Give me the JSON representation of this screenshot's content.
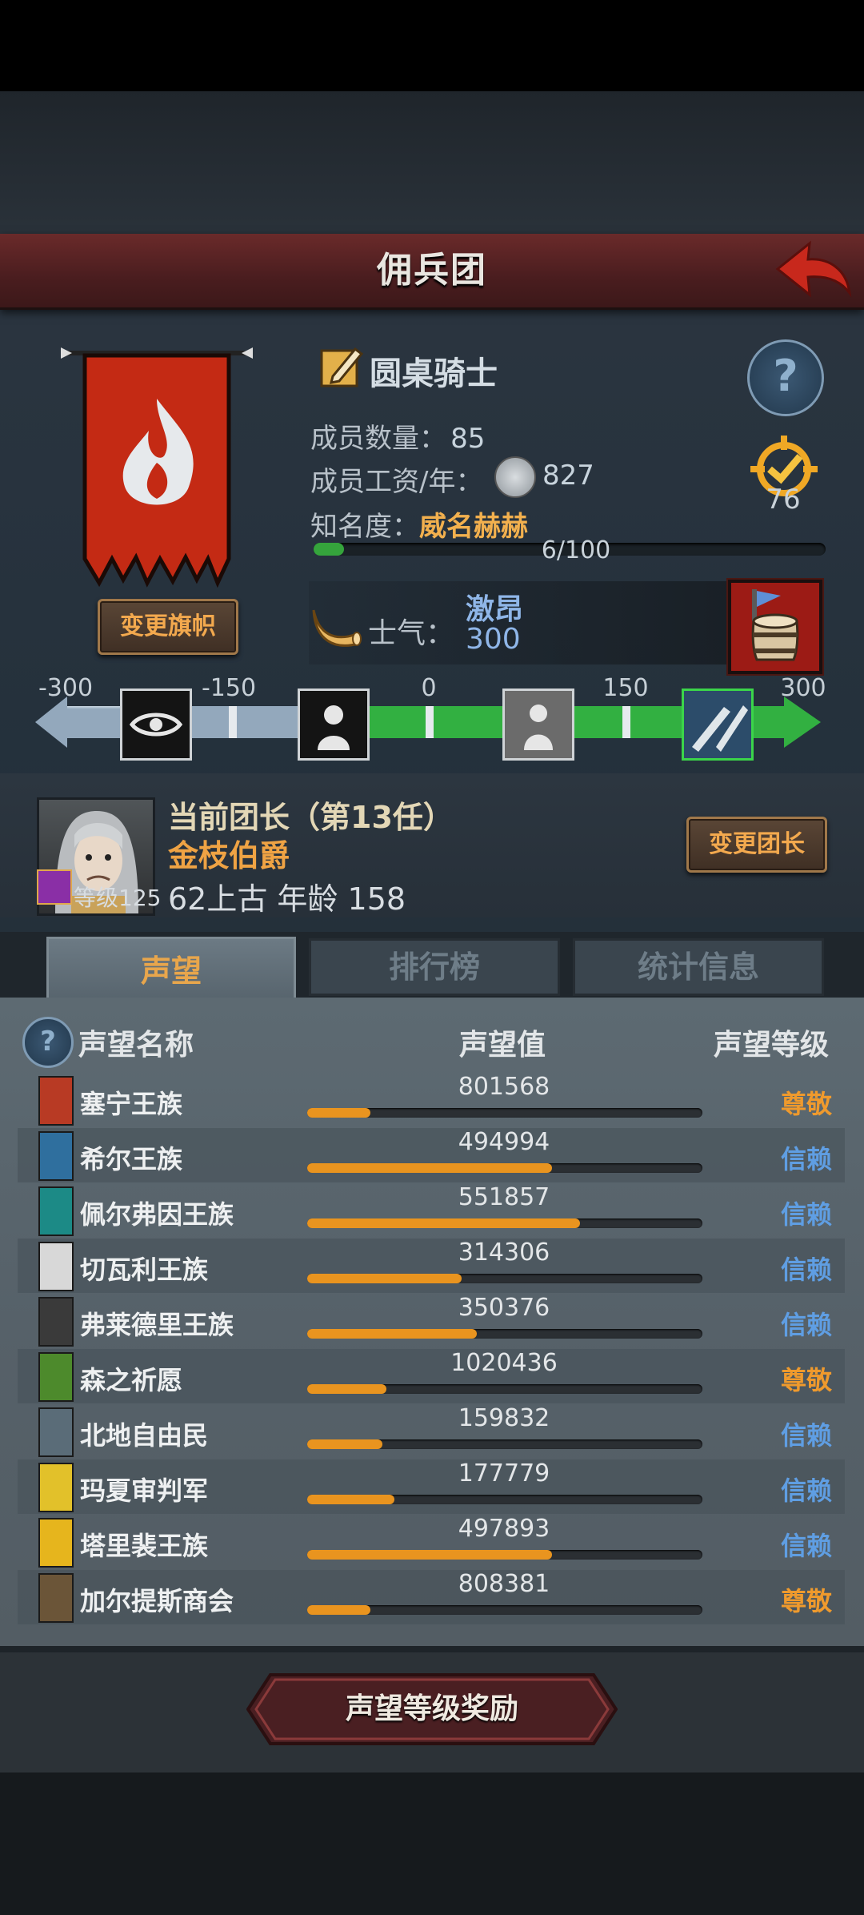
{
  "header": {
    "title": "佣兵团",
    "back_icon": "back-arrow-icon"
  },
  "company": {
    "name": "圆桌骑士",
    "member_count_label": "成员数量：",
    "member_count": "85",
    "salary_label": "成员工资/年：",
    "salary": "827",
    "fame_label": "知名度：",
    "fame_value": "威名赫赫",
    "fame_progress": "6/100",
    "fame_fraction": 0.06,
    "target_value": "76",
    "change_banner_label": "变更旗帜"
  },
  "morale": {
    "label": "士气：",
    "state": "激昂",
    "value": "300",
    "scale_ticks": [
      "-300",
      "-150",
      "0",
      "150",
      "300"
    ]
  },
  "leader": {
    "title": "当前团长（第13任）",
    "name": "金枝伯爵",
    "level": "等级125",
    "stats": "62上古 年龄 158",
    "change_label": "变更团长"
  },
  "tabs": [
    "声望",
    "排行榜",
    "统计信息"
  ],
  "table": {
    "headers": {
      "name": "声望名称",
      "value": "声望值",
      "level": "声望等级"
    },
    "rows": [
      {
        "name": "塞宁王族",
        "value": "801568",
        "level": "尊敬",
        "fill": 0.16,
        "icon_color": "#b83a24"
      },
      {
        "name": "希尔王族",
        "value": "494994",
        "level": "信赖",
        "fill": 0.62,
        "icon_color": "#2f6f9e"
      },
      {
        "name": "佩尔弗因王族",
        "value": "551857",
        "level": "信赖",
        "fill": 0.69,
        "icon_color": "#1c8a86"
      },
      {
        "name": "切瓦利王族",
        "value": "314306",
        "level": "信赖",
        "fill": 0.39,
        "icon_color": "#d8d8d8"
      },
      {
        "name": "弗莱德里王族",
        "value": "350376",
        "level": "信赖",
        "fill": 0.43,
        "icon_color": "#3a3a3a"
      },
      {
        "name": "森之祈愿",
        "value": "1020436",
        "level": "尊敬",
        "fill": 0.2,
        "icon_color": "#4d8a2c"
      },
      {
        "name": "北地自由民",
        "value": "159832",
        "level": "信赖",
        "fill": 0.19,
        "icon_color": "#5a6c78"
      },
      {
        "name": "玛夏审判军",
        "value": "177779",
        "level": "信赖",
        "fill": 0.22,
        "icon_color": "#e2c12a"
      },
      {
        "name": "塔里裴王族",
        "value": "497893",
        "level": "信赖",
        "fill": 0.62,
        "icon_color": "#e6b51d"
      },
      {
        "name": "加尔提斯商会",
        "value": "808381",
        "level": "尊敬",
        "fill": 0.16,
        "icon_color": "#6b5538"
      }
    ]
  },
  "level_colors": {
    "尊敬": "#ef9a2d",
    "信赖": "#5f9ee3"
  },
  "reward_button": "声望等级奖励"
}
